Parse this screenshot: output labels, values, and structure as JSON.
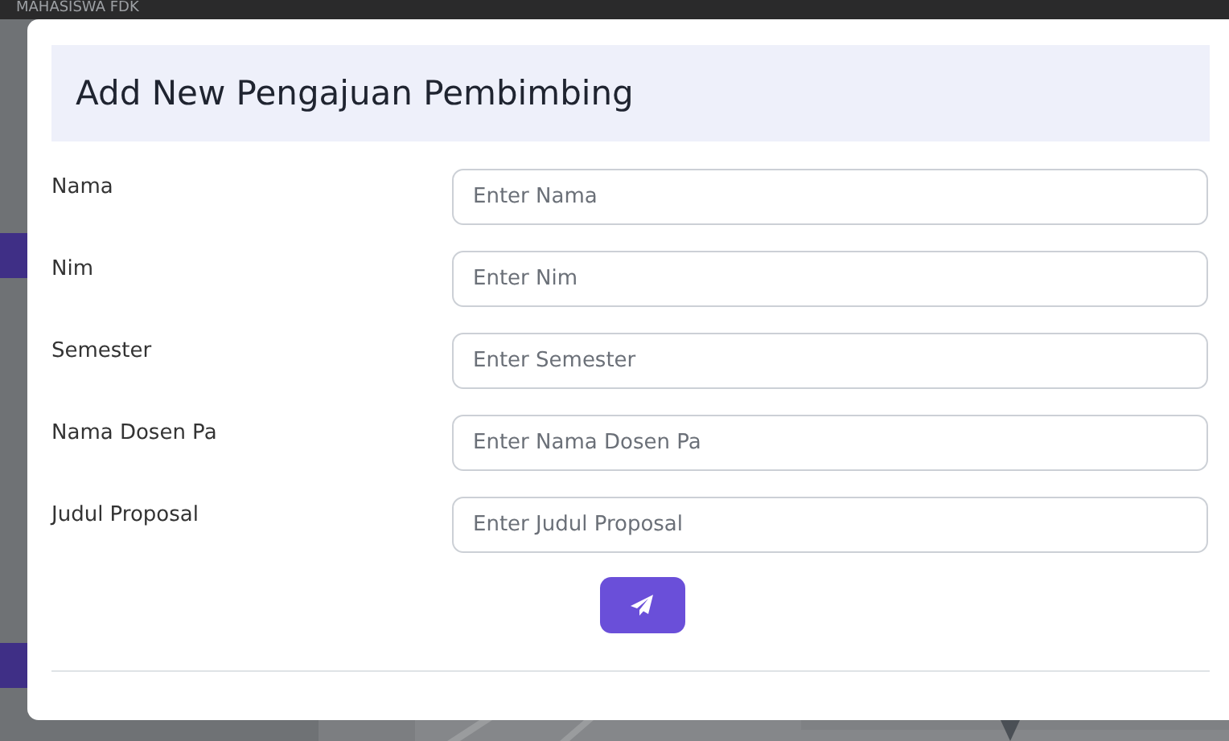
{
  "page": {
    "header_title": "MAHASISWA FDK"
  },
  "modal": {
    "title": "Add New Pengajuan Pembimbing",
    "fields": [
      {
        "label": "Nama",
        "placeholder": "Enter Nama"
      },
      {
        "label": "Nim",
        "placeholder": "Enter Nim"
      },
      {
        "label": "Semester",
        "placeholder": "Enter Semester"
      },
      {
        "label": "Nama Dosen Pa",
        "placeholder": "Enter Nama Dosen Pa"
      },
      {
        "label": "Judul Proposal",
        "placeholder": "Enter Judul Proposal"
      }
    ],
    "submit": {
      "kind": "send"
    }
  }
}
